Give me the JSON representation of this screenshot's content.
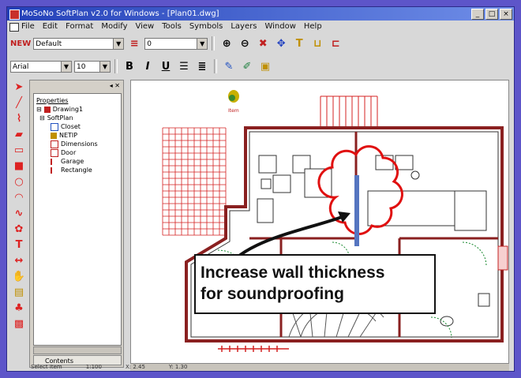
{
  "window": {
    "title": "MoSoNo SoftPlan v2.0 for Windows - [Plan01.dwg]"
  },
  "menu": [
    "File",
    "Edit",
    "Format",
    "Modify",
    "View",
    "Tools",
    "Symbols",
    "Layers",
    "Window",
    "Help"
  ],
  "toolbar1": {
    "new_label": "NEW",
    "layer_value": "Default",
    "width_value": "0"
  },
  "toolbar2": {
    "font_value": "Arial",
    "size_value": "10",
    "bold": "B",
    "italic": "I",
    "underline": "U"
  },
  "tree": {
    "panel_title": "Properties",
    "root": "Drawing1",
    "group": "SoftPlan",
    "items": [
      "Closet",
      "NETIP",
      "Dimensions",
      "Door",
      "Garage",
      "Rectangle"
    ],
    "tab_label": "Contents"
  },
  "canvas": {
    "callout_line1": "Increase wall thickness",
    "callout_line2": "for soundproofing",
    "marker_label": "Item"
  },
  "statusbar": [
    "Select Item",
    "1:100",
    "X: 2.45",
    "Y: 1.30"
  ],
  "colors": {
    "accent": "#d42020",
    "outline": "#5d55c9",
    "title": "#2340b8"
  }
}
